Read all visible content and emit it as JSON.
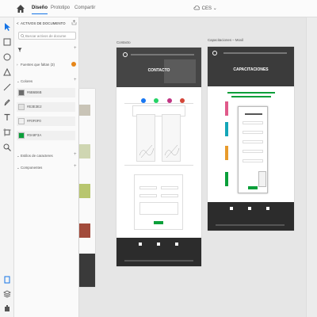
{
  "topbar": {
    "tabs": [
      {
        "label": "Diseño",
        "active": true
      },
      {
        "label": "Prototipo",
        "active": false
      },
      {
        "label": "Compartir",
        "active": false
      }
    ],
    "document_name": "CES",
    "zoom_indicator": "⌄"
  },
  "assets_panel": {
    "header": "ACTIVOS DE DOCUMENTO",
    "search_placeholder": "Buscar activos de docume",
    "fonts_section": "Fuentes que faltan (3)",
    "colors_section": "Colores",
    "colors": [
      {
        "hex_label": "#6B6B6B",
        "swatch": "#6b6b6b"
      },
      {
        "hex_label": "#E3E3E2",
        "swatch": "#e3e3e2"
      },
      {
        "hex_label": "#F0F0F0",
        "swatch": "#f0f0f0"
      },
      {
        "hex_label": "#0A9F3A",
        "swatch": "#0a9f3a"
      }
    ],
    "char_styles_section": "Estilos de caracteres",
    "components_section": "Componentes"
  },
  "artboards": [
    {
      "title": "Contacto",
      "hero_text": "CONTACTO"
    },
    {
      "title": "Capacitaciones – Movil",
      "hero_text": "CAPACITACIONES"
    }
  ]
}
